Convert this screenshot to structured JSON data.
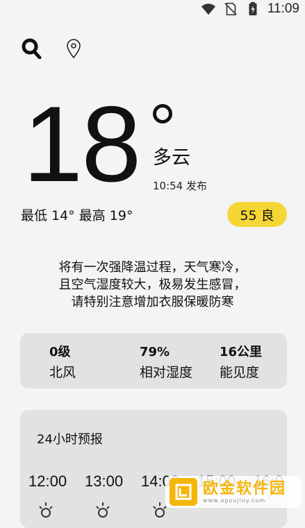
{
  "status_bar": {
    "time": "11:09"
  },
  "weather": {
    "temperature": "18",
    "condition": "多云",
    "published": "10:54 发布",
    "range": "最低 14° 最高 19°",
    "aqi": "55 良",
    "advice": [
      "将有一次强降温过程，天气寒冷，",
      "且空气湿度较大，极易发生感冒，",
      "请特别注意增加衣服保暖防寒"
    ]
  },
  "stats": [
    {
      "value": "0级",
      "label": "北风"
    },
    {
      "value": "79%",
      "label": "相对湿度"
    },
    {
      "value": "16公里",
      "label": "能见度"
    }
  ],
  "forecast": {
    "title": "24小时预报",
    "hours": [
      "12:00",
      "13:00",
      "14:00",
      "15:00",
      "16:0"
    ]
  },
  "watermark": {
    "name": "欧金软件园",
    "url": "www.apoujiny.com"
  },
  "colors": {
    "background": "#f4f4f4",
    "card": "#e2e2e2",
    "aqi_badge": "#f5d634",
    "watermark": "#f5b60a"
  }
}
